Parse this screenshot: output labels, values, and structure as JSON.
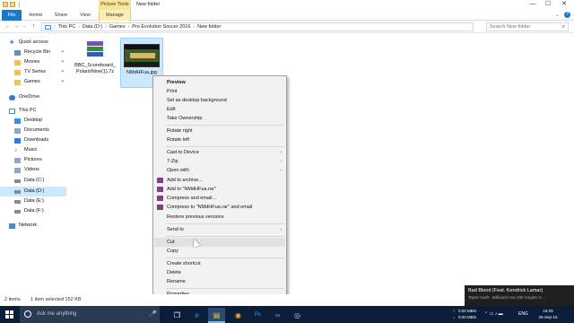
{
  "titlebar": {
    "contextual_tab": "Picture Tools",
    "window_title": "New folder",
    "minimize": "—",
    "maximize": "☐",
    "close": "✕"
  },
  "ribbon": {
    "tabs": [
      "File",
      "Home",
      "Share",
      "View",
      "Manage"
    ],
    "expand": "⌄",
    "help": "?"
  },
  "address": {
    "back": "←",
    "forward": "→",
    "recent": "⌄",
    "up": "↑",
    "path": [
      "This PC",
      "Data (D:)",
      "Games",
      "Pro Evolution Soccer 2016",
      "New folder"
    ],
    "separator": "›",
    "search_placeholder": "Search New folder",
    "search_icon": "⌕"
  },
  "nav": {
    "items": [
      {
        "label": "Quick access",
        "icon": "star-icon",
        "color": "#2f7fd6"
      },
      {
        "label": "Recycle Bin",
        "icon": "recycle-bin-icon",
        "color": "#6a8fb5",
        "pinned": true
      },
      {
        "label": "Movies",
        "icon": "folder-icon",
        "color": "#e9c45c",
        "pinned": true
      },
      {
        "label": "TV Series",
        "icon": "folder-icon",
        "color": "#e9c45c",
        "pinned": true
      },
      {
        "label": "Games",
        "icon": "folder-icon",
        "color": "#e9c45c",
        "pinned": true
      },
      {
        "label": "OneDrive",
        "icon": "cloud-icon",
        "color": "#2f7fd6"
      },
      {
        "label": "This PC",
        "icon": "computer-icon",
        "color": "#4b8bd1"
      },
      {
        "label": "Desktop",
        "icon": "desktop-icon",
        "color": "#3d8fe0"
      },
      {
        "label": "Documents",
        "icon": "documents-icon",
        "color": "#8fa8c7"
      },
      {
        "label": "Downloads",
        "icon": "downloads-icon",
        "color": "#2f7fd6"
      },
      {
        "label": "Music",
        "icon": "music-icon",
        "color": "#4b8bd1"
      },
      {
        "label": "Pictures",
        "icon": "pictures-icon",
        "color": "#8fa8c7"
      },
      {
        "label": "Videos",
        "icon": "videos-icon",
        "color": "#8fa8c7"
      },
      {
        "label": "Data (C:)",
        "icon": "drive-icon",
        "color": "#8a8a8a"
      },
      {
        "label": "Data (D:)",
        "icon": "drive-icon",
        "color": "#8a8a8a",
        "selected": true
      },
      {
        "label": "Data (E:)",
        "icon": "drive-icon",
        "color": "#8a8a8a"
      },
      {
        "label": "Data (F:)",
        "icon": "drive-icon",
        "color": "#8a8a8a"
      },
      {
        "label": "Network",
        "icon": "network-icon",
        "color": "#4b8bd1"
      }
    ],
    "pin_glyph": "✦"
  },
  "files": [
    {
      "name_line1": "BBC_Scoreboard_",
      "name_line2": "PolarisNine(1).7z",
      "icon": "archive-icon"
    },
    {
      "name_line1": "NMdHFua.jpg",
      "icon": "image-thumbnail",
      "selected": true
    }
  ],
  "context_menu": {
    "items": [
      {
        "label": "Preview",
        "bold": true
      },
      {
        "label": "Print"
      },
      {
        "label": "Set as desktop background"
      },
      {
        "label": "Edit"
      },
      {
        "label": "Take Ownership"
      },
      {
        "sep": true
      },
      {
        "label": "Rotate right"
      },
      {
        "label": "Rotate left"
      },
      {
        "sep": true
      },
      {
        "label": "Cast to Device",
        "submenu": true
      },
      {
        "label": "7-Zip",
        "submenu": true
      },
      {
        "label": "Open with",
        "submenu": true
      },
      {
        "label": "Add to archive...",
        "icon": true
      },
      {
        "label": "Add to \"NMdHFua.rar\"",
        "icon": true
      },
      {
        "label": "Compress and email...",
        "icon": true
      },
      {
        "label": "Compress to \"NMdHFua.rar\" and email",
        "icon": true
      },
      {
        "label": "Restore previous versions"
      },
      {
        "sep": true
      },
      {
        "label": "Send to",
        "submenu": true
      },
      {
        "sep": true
      },
      {
        "label": "Cut",
        "hover": true
      },
      {
        "label": "Copy"
      },
      {
        "sep": true
      },
      {
        "label": "Create shortcut"
      },
      {
        "label": "Delete"
      },
      {
        "label": "Rename"
      },
      {
        "sep": true
      },
      {
        "label": "Properties"
      }
    ],
    "submenu_arrow": "›",
    "archive_icon_color": "#8b3a8b"
  },
  "status": {
    "count": "2 items",
    "selection": "1 item selected  152 KB"
  },
  "notification": {
    "title": "Bad Blood (Feat. Kendrick Lamar)",
    "subtitle": "Taylor Swift - Billboard Hot 100 Singles C..."
  },
  "taskbar": {
    "search_placeholder": "Ask me anything",
    "mic": "🎤",
    "apps": [
      {
        "name": "task-view-icon",
        "glyph": "❐"
      },
      {
        "name": "edge-icon",
        "glyph": "e"
      },
      {
        "name": "file-explorer-icon",
        "glyph": "▤",
        "active": true
      },
      {
        "name": "chrome-icon",
        "glyph": "◉"
      },
      {
        "name": "photoshop-icon",
        "glyph": "Ps"
      },
      {
        "name": "visual-studio-icon",
        "glyph": "∞"
      },
      {
        "name": "steam-icon",
        "glyph": "◎"
      }
    ],
    "net_up": "0.00 MB/s",
    "net_down": "0.00 MB/s",
    "arrow_up": "↑",
    "arrow_down": "↓",
    "time": "16:29",
    "date": "26-Sep-15",
    "language": "ENG",
    "tray_glyphs": "⌃  ▭  ♪  ▬"
  }
}
